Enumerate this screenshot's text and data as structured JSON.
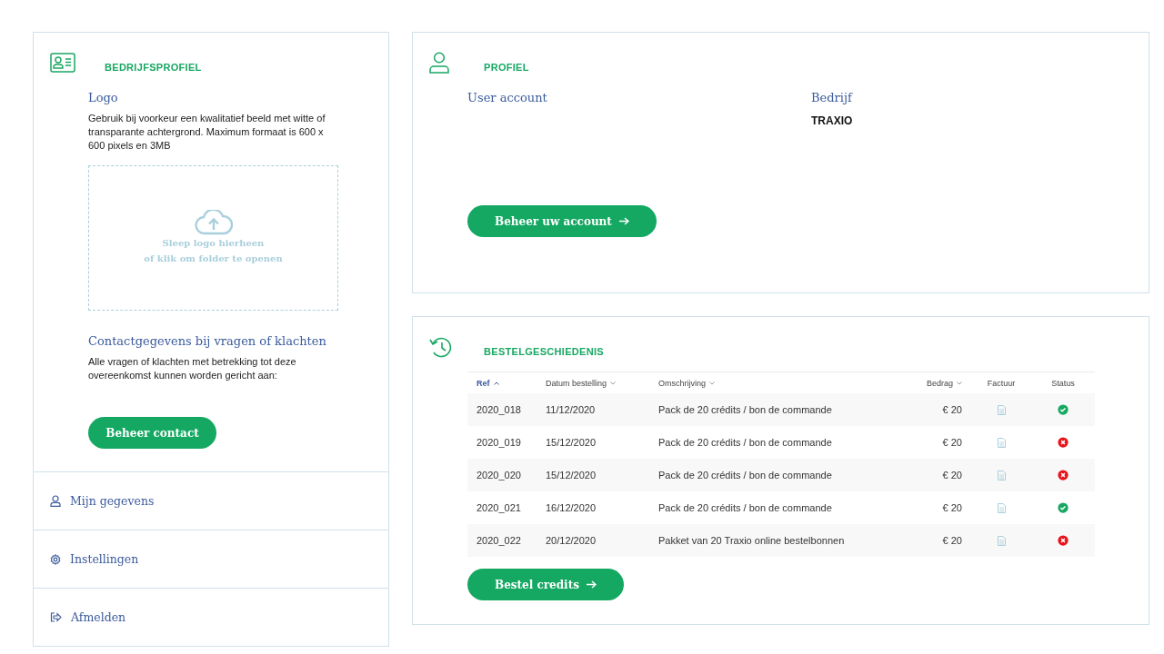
{
  "company_profile": {
    "title": "BEDRIJFSPROFIEL",
    "logo_label": "Logo",
    "logo_hint": "Gebruik bij voorkeur een kwalitatief beeld met witte of transparante achtergrond. Maximum formaat is 600 x 600 pixels en 3MB",
    "dropzone": [
      "Sleep logo hierheen",
      "of klik om folder te openen"
    ],
    "contact_title": "Contactgegevens bij vragen of klachten",
    "contact_text": "Alle vragen of klachten met betrekking tot deze overeenkomst kunnen worden gericht aan:",
    "contact_button": "Beheer contact"
  },
  "menu": [
    {
      "kind": "person",
      "label": "Mijn gegevens"
    },
    {
      "kind": "gear",
      "label": "Instellingen"
    },
    {
      "kind": "logout",
      "label": "Afmelden"
    }
  ],
  "profile": {
    "title": "PROFIEL",
    "fields": [
      {
        "label": "User account"
      },
      {
        "label": "Bedrijf",
        "value": "TRAXIO"
      }
    ],
    "button": "Beheer uw account"
  },
  "orders": {
    "title": "BESTELGESCHIEDENIS",
    "columns": [
      {
        "label": "Ref",
        "sortable": true,
        "selected": true
      },
      {
        "label": "Datum bestelling",
        "sortable": true,
        "selected": false
      },
      {
        "label": "Omschrijving",
        "sortable": true,
        "selected": false
      },
      {
        "label": "Bedrag",
        "sortable": true,
        "selected": false
      },
      {
        "label": "Factuur",
        "sortable": false,
        "selected": false
      },
      {
        "label": "Status",
        "sortable": false,
        "selected": false
      }
    ],
    "rows": [
      {
        "ref": "2020_018",
        "date": "11/12/2020",
        "description": "Pack de 20 crédits / bon de commande",
        "amount": "€ 20",
        "kind": "success"
      },
      {
        "ref": "2020_019",
        "date": "15/12/2020",
        "description": "Pack de 20 crédits / bon de commande",
        "amount": "€ 20",
        "kind": "error"
      },
      {
        "ref": "2020_020",
        "date": "15/12/2020",
        "description": "Pack de 20 crédits / bon de commande",
        "amount": "€ 20",
        "kind": "error"
      },
      {
        "ref": "2020_021",
        "date": "16/12/2020",
        "description": "Pack de 20 crédits / bon de commande",
        "amount": "€ 20",
        "kind": "success"
      },
      {
        "ref": "2020_022",
        "date": "20/12/2020",
        "description": "Pakket van 20 Traxio online bestelbonnen",
        "amount": "€ 20",
        "kind": "error"
      }
    ],
    "button": "Bestel credits"
  }
}
